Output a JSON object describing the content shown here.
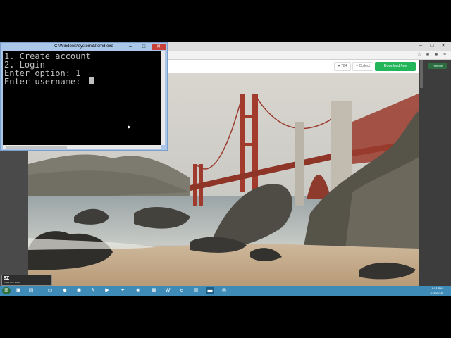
{
  "cmd": {
    "title": "C:\\Windows\\system32\\cmd.exe",
    "lines": [
      "1. Create account",
      "2. Login",
      "Enter option: 1",
      "Enter username: "
    ],
    "controls": {
      "minimize": "–",
      "maximize": "□",
      "close": "✕"
    }
  },
  "browser": {
    "window_controls": {
      "minimize": "–",
      "maximize": "□",
      "close": "✕"
    },
    "header_buttons": {
      "like": "♥ 784",
      "collect": "+ Collect",
      "download": "Download free"
    },
    "hire_button": "Hire Me"
  },
  "overlay": {
    "text": "8Z",
    "sub": "Vivant    ICM    Video"
  },
  "taskbar": {
    "time": "8:51 PM",
    "date": "7/18/2018"
  }
}
